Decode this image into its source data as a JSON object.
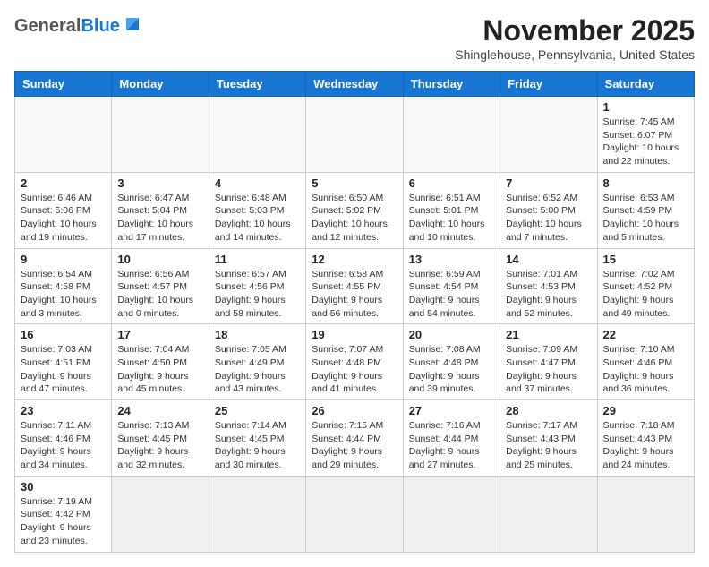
{
  "header": {
    "logo_general": "General",
    "logo_blue": "Blue",
    "month_title": "November 2025",
    "subtitle": "Shinglehouse, Pennsylvania, United States"
  },
  "days_of_week": [
    "Sunday",
    "Monday",
    "Tuesday",
    "Wednesday",
    "Thursday",
    "Friday",
    "Saturday"
  ],
  "weeks": [
    [
      {
        "day": "",
        "info": ""
      },
      {
        "day": "",
        "info": ""
      },
      {
        "day": "",
        "info": ""
      },
      {
        "day": "",
        "info": ""
      },
      {
        "day": "",
        "info": ""
      },
      {
        "day": "",
        "info": ""
      },
      {
        "day": "1",
        "info": "Sunrise: 7:45 AM\nSunset: 6:07 PM\nDaylight: 10 hours and 22 minutes."
      }
    ],
    [
      {
        "day": "2",
        "info": "Sunrise: 6:46 AM\nSunset: 5:06 PM\nDaylight: 10 hours and 19 minutes."
      },
      {
        "day": "3",
        "info": "Sunrise: 6:47 AM\nSunset: 5:04 PM\nDaylight: 10 hours and 17 minutes."
      },
      {
        "day": "4",
        "info": "Sunrise: 6:48 AM\nSunset: 5:03 PM\nDaylight: 10 hours and 14 minutes."
      },
      {
        "day": "5",
        "info": "Sunrise: 6:50 AM\nSunset: 5:02 PM\nDaylight: 10 hours and 12 minutes."
      },
      {
        "day": "6",
        "info": "Sunrise: 6:51 AM\nSunset: 5:01 PM\nDaylight: 10 hours and 10 minutes."
      },
      {
        "day": "7",
        "info": "Sunrise: 6:52 AM\nSunset: 5:00 PM\nDaylight: 10 hours and 7 minutes."
      },
      {
        "day": "8",
        "info": "Sunrise: 6:53 AM\nSunset: 4:59 PM\nDaylight: 10 hours and 5 minutes."
      }
    ],
    [
      {
        "day": "9",
        "info": "Sunrise: 6:54 AM\nSunset: 4:58 PM\nDaylight: 10 hours and 3 minutes."
      },
      {
        "day": "10",
        "info": "Sunrise: 6:56 AM\nSunset: 4:57 PM\nDaylight: 10 hours and 0 minutes."
      },
      {
        "day": "11",
        "info": "Sunrise: 6:57 AM\nSunset: 4:56 PM\nDaylight: 9 hours and 58 minutes."
      },
      {
        "day": "12",
        "info": "Sunrise: 6:58 AM\nSunset: 4:55 PM\nDaylight: 9 hours and 56 minutes."
      },
      {
        "day": "13",
        "info": "Sunrise: 6:59 AM\nSunset: 4:54 PM\nDaylight: 9 hours and 54 minutes."
      },
      {
        "day": "14",
        "info": "Sunrise: 7:01 AM\nSunset: 4:53 PM\nDaylight: 9 hours and 52 minutes."
      },
      {
        "day": "15",
        "info": "Sunrise: 7:02 AM\nSunset: 4:52 PM\nDaylight: 9 hours and 49 minutes."
      }
    ],
    [
      {
        "day": "16",
        "info": "Sunrise: 7:03 AM\nSunset: 4:51 PM\nDaylight: 9 hours and 47 minutes."
      },
      {
        "day": "17",
        "info": "Sunrise: 7:04 AM\nSunset: 4:50 PM\nDaylight: 9 hours and 45 minutes."
      },
      {
        "day": "18",
        "info": "Sunrise: 7:05 AM\nSunset: 4:49 PM\nDaylight: 9 hours and 43 minutes."
      },
      {
        "day": "19",
        "info": "Sunrise: 7:07 AM\nSunset: 4:48 PM\nDaylight: 9 hours and 41 minutes."
      },
      {
        "day": "20",
        "info": "Sunrise: 7:08 AM\nSunset: 4:48 PM\nDaylight: 9 hours and 39 minutes."
      },
      {
        "day": "21",
        "info": "Sunrise: 7:09 AM\nSunset: 4:47 PM\nDaylight: 9 hours and 37 minutes."
      },
      {
        "day": "22",
        "info": "Sunrise: 7:10 AM\nSunset: 4:46 PM\nDaylight: 9 hours and 36 minutes."
      }
    ],
    [
      {
        "day": "23",
        "info": "Sunrise: 7:11 AM\nSunset: 4:46 PM\nDaylight: 9 hours and 34 minutes."
      },
      {
        "day": "24",
        "info": "Sunrise: 7:13 AM\nSunset: 4:45 PM\nDaylight: 9 hours and 32 minutes."
      },
      {
        "day": "25",
        "info": "Sunrise: 7:14 AM\nSunset: 4:45 PM\nDaylight: 9 hours and 30 minutes."
      },
      {
        "day": "26",
        "info": "Sunrise: 7:15 AM\nSunset: 4:44 PM\nDaylight: 9 hours and 29 minutes."
      },
      {
        "day": "27",
        "info": "Sunrise: 7:16 AM\nSunset: 4:44 PM\nDaylight: 9 hours and 27 minutes."
      },
      {
        "day": "28",
        "info": "Sunrise: 7:17 AM\nSunset: 4:43 PM\nDaylight: 9 hours and 25 minutes."
      },
      {
        "day": "29",
        "info": "Sunrise: 7:18 AM\nSunset: 4:43 PM\nDaylight: 9 hours and 24 minutes."
      }
    ],
    [
      {
        "day": "30",
        "info": "Sunrise: 7:19 AM\nSunset: 4:42 PM\nDaylight: 9 hours and 23 minutes."
      },
      {
        "day": "",
        "info": ""
      },
      {
        "day": "",
        "info": ""
      },
      {
        "day": "",
        "info": ""
      },
      {
        "day": "",
        "info": ""
      },
      {
        "day": "",
        "info": ""
      },
      {
        "day": "",
        "info": ""
      }
    ]
  ]
}
